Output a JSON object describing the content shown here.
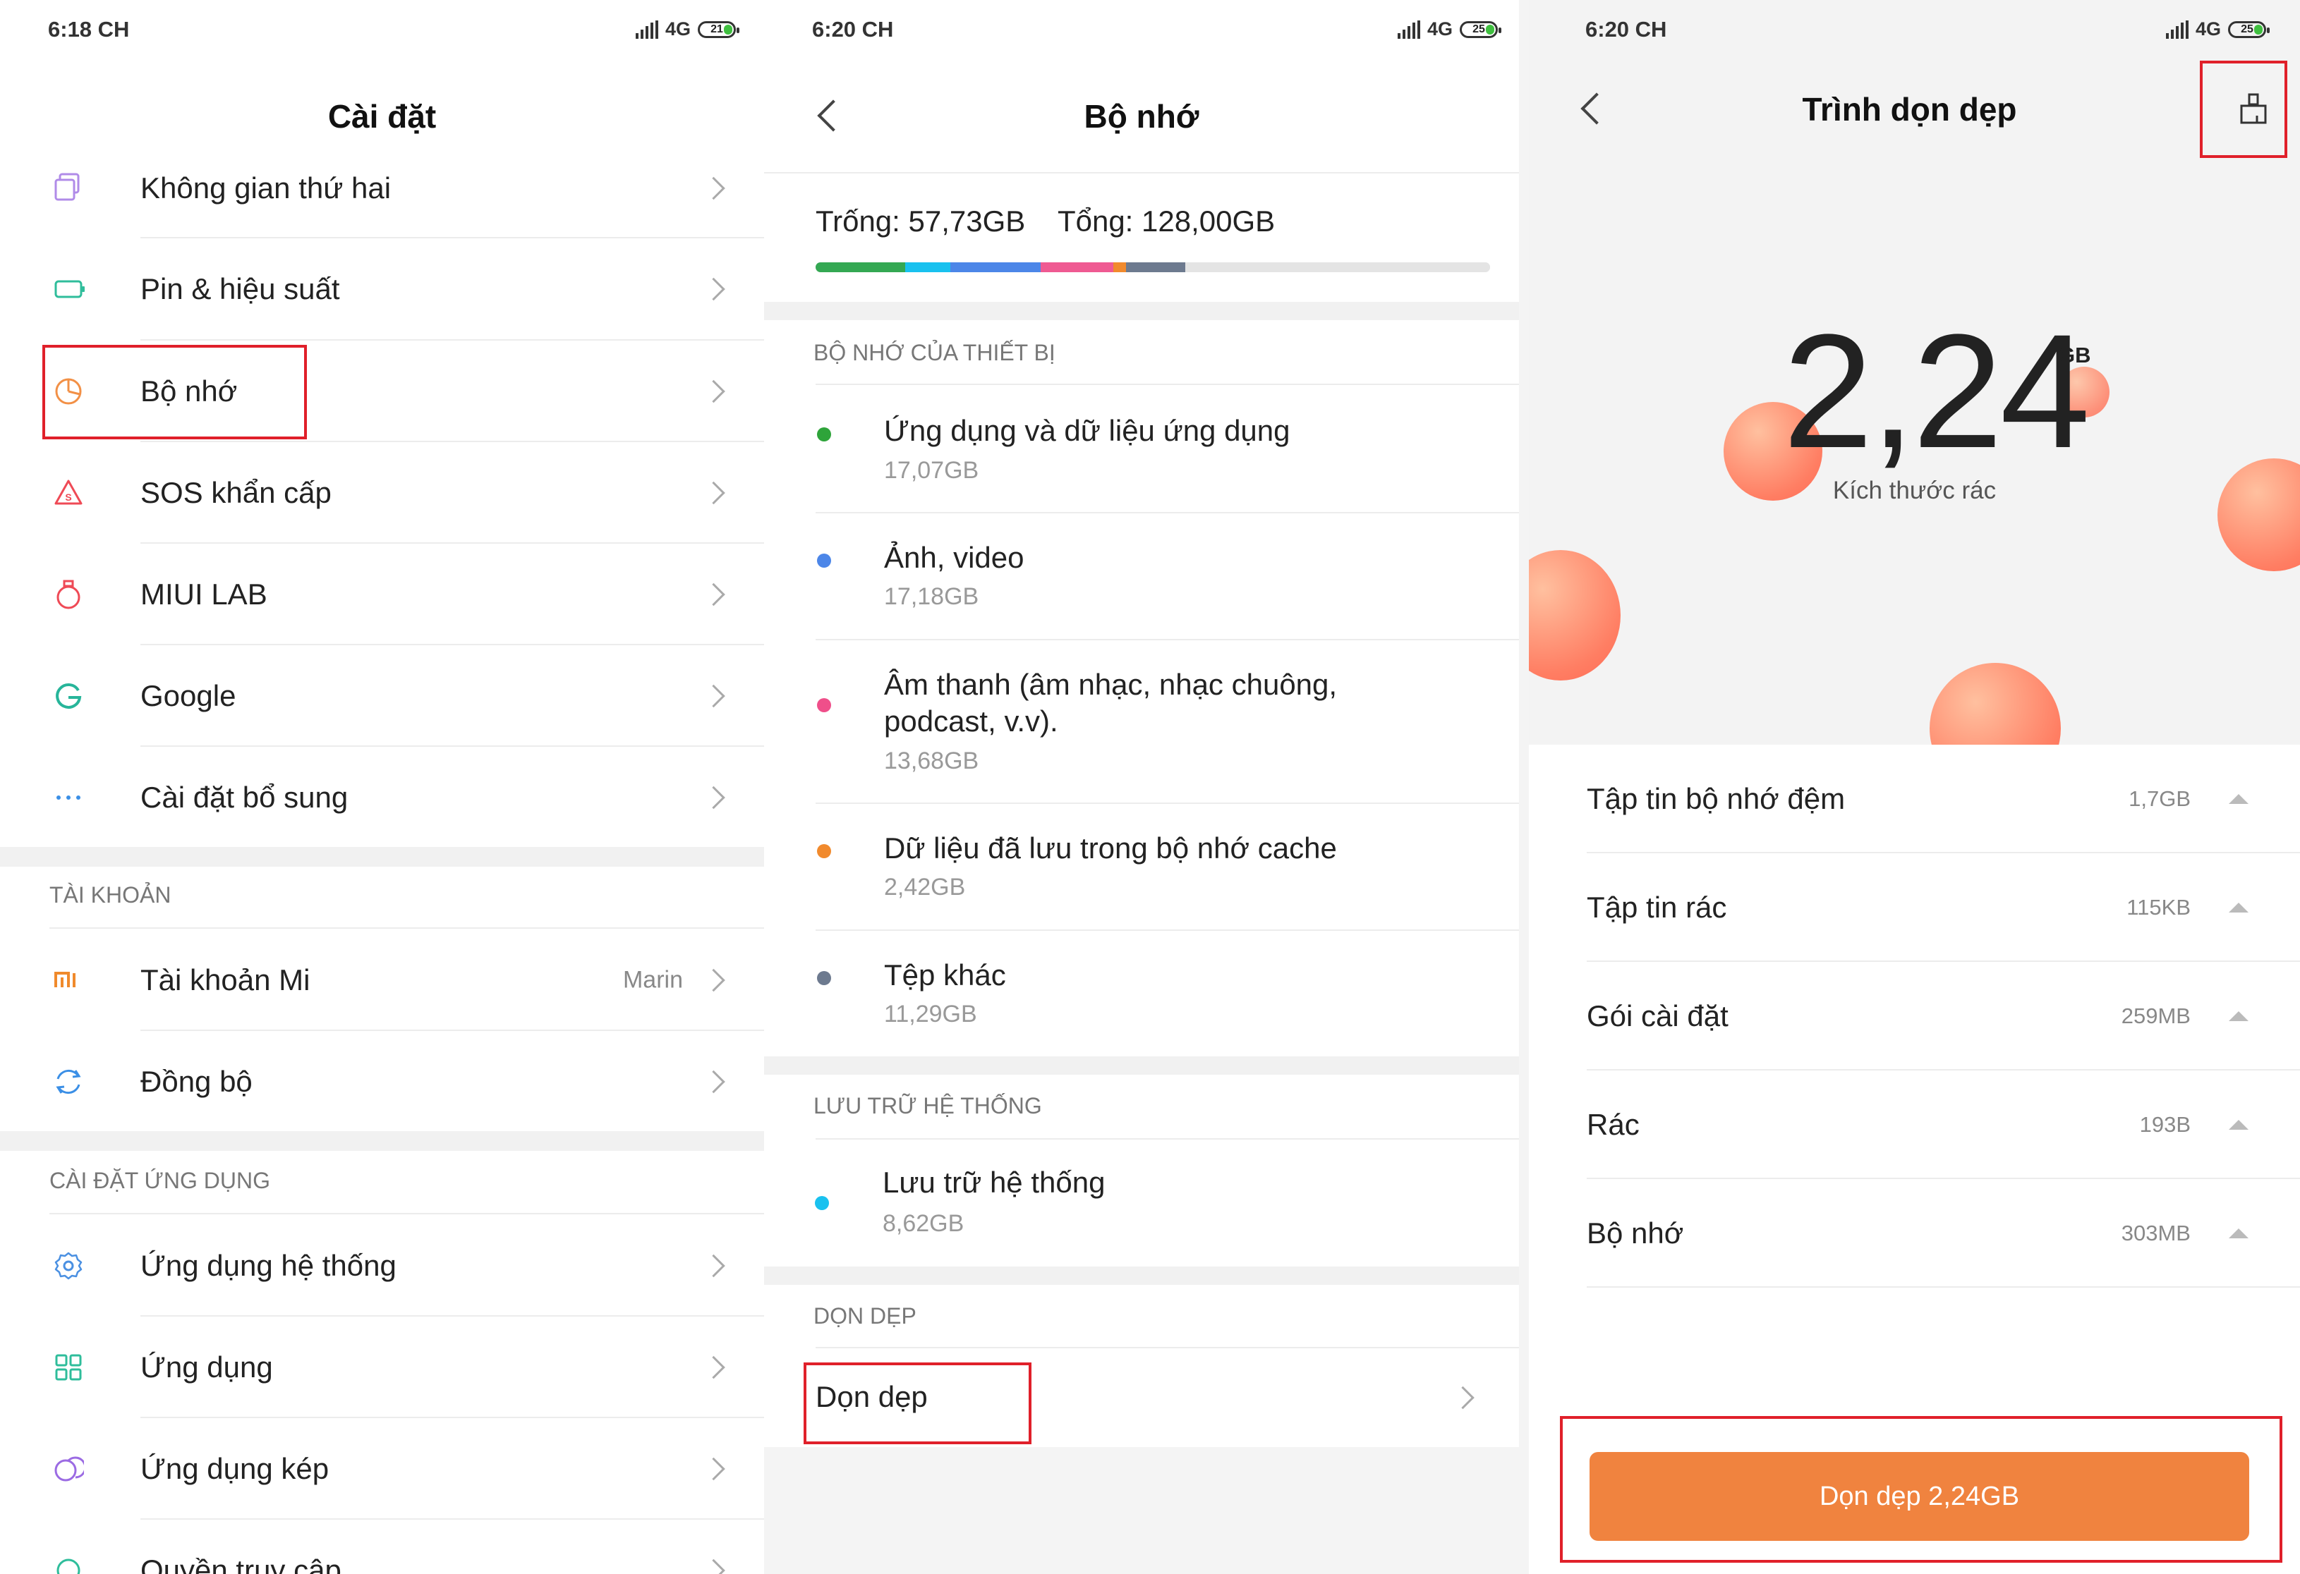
{
  "panel1": {
    "status": {
      "time": "6:18 CH",
      "network": "4G",
      "battery": "21"
    },
    "title": "Cài đặt",
    "items": [
      {
        "label": "Không gian thứ hai"
      },
      {
        "label": "Pin & hiệu suất"
      },
      {
        "label": "Bộ nhớ"
      },
      {
        "label": "SOS khẩn cấp"
      },
      {
        "label": "MIUI LAB"
      },
      {
        "label": "Google"
      },
      {
        "label": "Cài đặt bổ sung"
      }
    ],
    "account_section": "TÀI KHOẢN",
    "account_items": [
      {
        "label": "Tài khoản Mi",
        "value": "Marin"
      },
      {
        "label": "Đồng bộ"
      }
    ],
    "apps_section": "CÀI ĐẶT ỨNG DỤNG",
    "app_items": [
      {
        "label": "Ứng dụng hệ thống"
      },
      {
        "label": "Ứng dụng"
      },
      {
        "label": "Ứng dụng kép"
      },
      {
        "label": "Quyền truy cập"
      }
    ]
  },
  "panel2": {
    "status": {
      "time": "6:20 CH",
      "network": "4G",
      "battery": "25"
    },
    "title": "Bộ nhớ",
    "free": "Trống: 57,73GB",
    "total": "Tổng: 128,00GB",
    "usage_bar": [
      {
        "color": "#34a853",
        "fraction": 0.133
      },
      {
        "color": "#19c1ef",
        "fraction": 0.067
      },
      {
        "color": "#4c86e8",
        "fraction": 0.134
      },
      {
        "color": "#ef5a92",
        "fraction": 0.107
      },
      {
        "color": "#f18a2d",
        "fraction": 0.019
      },
      {
        "color": "#6d7a8f",
        "fraction": 0.088
      },
      {
        "color": "#e4e4e4",
        "fraction": 0.452
      }
    ],
    "device_section": "BỘ NHỚ CỦA THIẾT BỊ",
    "device_items": [
      {
        "name": "Ứng dụng và dữ liệu ứng dụng",
        "size": "17,07GB",
        "color": "#2ea43a"
      },
      {
        "name": "Ảnh, video",
        "size": "17,18GB",
        "color": "#4c86e8"
      },
      {
        "name": "Âm thanh (âm nhạc, nhạc chuông,",
        "name2": "podcast, v.v).",
        "size": "13,68GB",
        "color": "#ef4f8a"
      },
      {
        "name": "Dữ liệu đã lưu trong bộ nhớ cache",
        "size": "2,42GB",
        "color": "#f18a2d"
      },
      {
        "name": "Tệp khác",
        "size": "11,29GB",
        "color": "#6d7a8f"
      }
    ],
    "system_section": "LƯU TRỮ HỆ THỐNG",
    "system_item": {
      "name": "Lưu trữ hệ thống",
      "size": "8,62GB",
      "color": "#19c1ef"
    },
    "clean_section": "DỌN DẸP",
    "clean_item": "Dọn dẹp"
  },
  "panel3": {
    "status": {
      "time": "6:20 CH",
      "network": "4G",
      "battery": "25"
    },
    "title": "Trình dọn dẹp",
    "junk_size": "2,24",
    "junk_unit": "GB",
    "junk_label": "Kích thước rác",
    "items": [
      {
        "name": "Tập tin bộ nhớ đệm",
        "size": "1,7GB"
      },
      {
        "name": "Tập tin rác",
        "size": "115KB"
      },
      {
        "name": "Gói cài đặt",
        "size": "259MB"
      },
      {
        "name": "Rác",
        "size": "193B"
      },
      {
        "name": "Bộ nhớ",
        "size": "303MB"
      }
    ],
    "clean_button": "Dọn dẹp 2,24GB"
  }
}
